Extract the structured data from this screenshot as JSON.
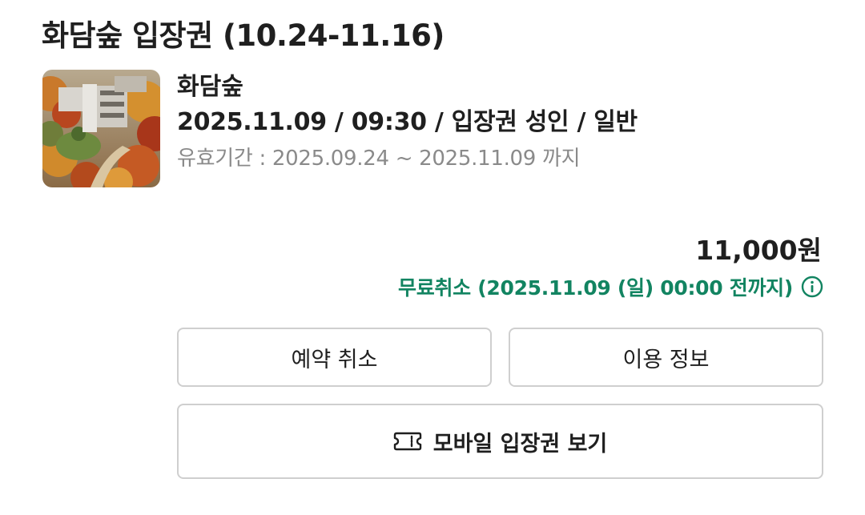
{
  "header": {
    "title": "화담숲 입장권 (10.24-11.16)"
  },
  "thumbnail": {
    "alt": "화담숲"
  },
  "booking": {
    "venue": "화담숲",
    "detail": "2025.11.09 / 09:30 / 입장권 성인 / 일반",
    "validity": "유효기간 : 2025.09.24 ~ 2025.11.09 까지"
  },
  "pricing": {
    "price": "11,000원",
    "free_cancel": "무료취소 (2025.11.09 (일) 00:00 전까지)"
  },
  "actions": {
    "cancel_label": "예약 취소",
    "info_label": "이용 정보",
    "mobile_ticket_label": "모바일 입장권 보기"
  },
  "icons": {
    "info": "info-icon",
    "ticket": "ticket-icon"
  },
  "colors": {
    "accent_green": "#128461",
    "border": "#cfcfcf",
    "muted_text": "#8a8a8a"
  }
}
